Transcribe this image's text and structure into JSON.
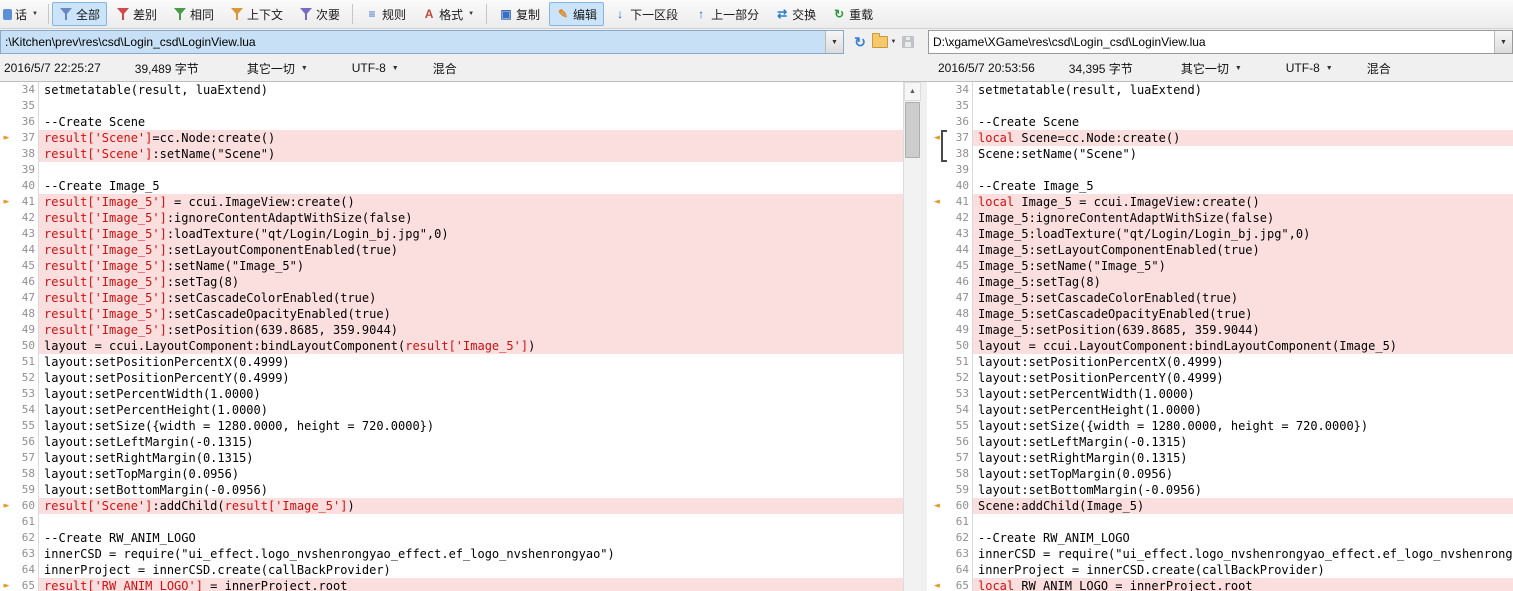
{
  "toolbar": {
    "session": {
      "label": "话"
    },
    "buttons": [
      {
        "label": "全部",
        "icon": "filter-all-icon",
        "active": true
      },
      {
        "label": "差别",
        "icon": "filter-differences-icon"
      },
      {
        "label": "相同",
        "icon": "filter-same-icon"
      },
      {
        "label": "上下文",
        "icon": "filter-context-icon"
      },
      {
        "label": "次要",
        "icon": "filter-minor-icon"
      },
      {
        "sep": true
      },
      {
        "label": "规则",
        "icon": "rules-icon"
      },
      {
        "label": "格式",
        "icon": "format-icon",
        "dropdown": true
      },
      {
        "sep": true
      },
      {
        "label": "复制",
        "icon": "copy-icon"
      },
      {
        "label": "编辑",
        "icon": "edit-icon",
        "active": true
      },
      {
        "label": "下一区段",
        "icon": "next-section-icon"
      },
      {
        "label": "上一部分",
        "icon": "previous-part-icon"
      },
      {
        "label": "交换",
        "icon": "swap-icon"
      },
      {
        "label": "重载",
        "icon": "reload-icon"
      }
    ]
  },
  "colors": {
    "diff_bg": "#fbdfdf",
    "diff_text": "#d01010",
    "marker": "#e8971e",
    "path_selection_bg": "#c7e0f5"
  },
  "left_pane": {
    "path": ":\\Kitchen\\prev\\res\\csd\\Login_csd\\LoginView.lua",
    "info": {
      "modified": "2016/5/7 22:25:27",
      "size": "39,489 字节",
      "format": "其它一切",
      "encoding": "UTF-8",
      "line_ending": "混合"
    },
    "marker_glyph": "►",
    "lines": [
      {
        "n": 34,
        "s": [
          {
            "t": "setmetatable(result, luaExtend)"
          }
        ]
      },
      {
        "n": 35,
        "s": []
      },
      {
        "n": 36,
        "s": [
          {
            "t": "--Create Scene"
          }
        ]
      },
      {
        "n": 37,
        "d": true,
        "m": true,
        "s": [
          {
            "t": "result['Scene']",
            "r": true
          },
          {
            "t": "=cc.Node:create()"
          }
        ]
      },
      {
        "n": 38,
        "d": true,
        "s": [
          {
            "t": "result['Scene']",
            "r": true
          },
          {
            "t": ":setName(\"Scene\")"
          }
        ]
      },
      {
        "n": 39,
        "s": []
      },
      {
        "n": 40,
        "s": [
          {
            "t": "--Create Image_5"
          }
        ]
      },
      {
        "n": 41,
        "d": true,
        "m": true,
        "s": [
          {
            "t": "result['Image_5']",
            "r": true
          },
          {
            "t": " = ccui.ImageView:create()"
          }
        ]
      },
      {
        "n": 42,
        "d": true,
        "s": [
          {
            "t": "result['Image_5']",
            "r": true
          },
          {
            "t": ":ignoreContentAdaptWithSize(false)"
          }
        ]
      },
      {
        "n": 43,
        "d": true,
        "s": [
          {
            "t": "result['Image_5']",
            "r": true
          },
          {
            "t": ":loadTexture(\"qt/Login/Login_bj.jpg\",0)"
          }
        ]
      },
      {
        "n": 44,
        "d": true,
        "s": [
          {
            "t": "result['Image_5']",
            "r": true
          },
          {
            "t": ":setLayoutComponentEnabled(true)"
          }
        ]
      },
      {
        "n": 45,
        "d": true,
        "s": [
          {
            "t": "result['Image_5']",
            "r": true
          },
          {
            "t": ":setName(\"Image_5\")"
          }
        ]
      },
      {
        "n": 46,
        "d": true,
        "s": [
          {
            "t": "result['Image_5']",
            "r": true
          },
          {
            "t": ":setTag(8)"
          }
        ]
      },
      {
        "n": 47,
        "d": true,
        "s": [
          {
            "t": "result['Image_5']",
            "r": true
          },
          {
            "t": ":setCascadeColorEnabled(true)"
          }
        ]
      },
      {
        "n": 48,
        "d": true,
        "s": [
          {
            "t": "result['Image_5']",
            "r": true
          },
          {
            "t": ":setCascadeOpacityEnabled(true)"
          }
        ]
      },
      {
        "n": 49,
        "d": true,
        "s": [
          {
            "t": "result['Image_5']",
            "r": true
          },
          {
            "t": ":setPosition(639.8685, 359.9044)"
          }
        ]
      },
      {
        "n": 50,
        "d": true,
        "s": [
          {
            "t": "layout = ccui.LayoutComponent:bindLayoutComponent("
          },
          {
            "t": "result['Image_5']",
            "r": true
          },
          {
            "t": ")"
          }
        ]
      },
      {
        "n": 51,
        "s": [
          {
            "t": "layout:setPositionPercentX(0.4999)"
          }
        ]
      },
      {
        "n": 52,
        "s": [
          {
            "t": "layout:setPositionPercentY(0.4999)"
          }
        ]
      },
      {
        "n": 53,
        "s": [
          {
            "t": "layout:setPercentWidth(1.0000)"
          }
        ]
      },
      {
        "n": 54,
        "s": [
          {
            "t": "layout:setPercentHeight(1.0000)"
          }
        ]
      },
      {
        "n": 55,
        "s": [
          {
            "t": "layout:setSize({width = 1280.0000, height = 720.0000})"
          }
        ]
      },
      {
        "n": 56,
        "s": [
          {
            "t": "layout:setLeftMargin(-0.1315)"
          }
        ]
      },
      {
        "n": 57,
        "s": [
          {
            "t": "layout:setRightMargin(0.1315)"
          }
        ]
      },
      {
        "n": 58,
        "s": [
          {
            "t": "layout:setTopMargin(0.0956)"
          }
        ]
      },
      {
        "n": 59,
        "s": [
          {
            "t": "layout:setBottomMargin(-0.0956)"
          }
        ]
      },
      {
        "n": 60,
        "d": true,
        "m": true,
        "s": [
          {
            "t": "result['Scene']",
            "r": true
          },
          {
            "t": ":addChild("
          },
          {
            "t": "result['Image_5']",
            "r": true
          },
          {
            "t": ")"
          }
        ]
      },
      {
        "n": 61,
        "s": []
      },
      {
        "n": 62,
        "s": [
          {
            "t": "--Create RW_ANIM_LOGO"
          }
        ]
      },
      {
        "n": 63,
        "s": [
          {
            "t": "innerCSD = require(\"ui_effect.logo_nvshenrongyao_effect.ef_logo_nvshenrongyao\")"
          }
        ]
      },
      {
        "n": 64,
        "s": [
          {
            "t": "innerProject = innerCSD.create(callBackProvider)"
          }
        ]
      },
      {
        "n": 65,
        "d": true,
        "m": true,
        "s": [
          {
            "t": "result['RW_ANIM_LOGO']",
            "r": true
          },
          {
            "t": " = innerProject.root"
          }
        ]
      }
    ]
  },
  "right_pane": {
    "path": "D:\\xgame\\XGame\\res\\csd\\Login_csd\\LoginView.lua",
    "info": {
      "modified": "2016/5/7 20:53:56",
      "size": "34,395 字节",
      "format": "其它一切",
      "encoding": "UTF-8",
      "line_ending": "混合"
    },
    "marker_glyph": "◄",
    "lines": [
      {
        "n": 34,
        "s": [
          {
            "t": "setmetatable(result, luaExtend)"
          }
        ]
      },
      {
        "n": 35,
        "s": []
      },
      {
        "n": 36,
        "s": [
          {
            "t": "--Create Scene"
          }
        ]
      },
      {
        "n": 37,
        "d": true,
        "m": true,
        "s": [
          {
            "t": "local",
            "r": true
          },
          {
            "t": " Scene=cc.Node:create()"
          }
        ]
      },
      {
        "n": 38,
        "s": [
          {
            "t": "Scene:setName(\"Scene\")"
          }
        ]
      },
      {
        "n": 39,
        "s": []
      },
      {
        "n": 40,
        "s": [
          {
            "t": "--Create Image_5"
          }
        ]
      },
      {
        "n": 41,
        "d": true,
        "m": true,
        "s": [
          {
            "t": "local",
            "r": true
          },
          {
            "t": " Image_5 = ccui.ImageView:create()"
          }
        ]
      },
      {
        "n": 42,
        "d": true,
        "s": [
          {
            "t": "Image_5:ignoreContentAdaptWithSize(false)"
          }
        ]
      },
      {
        "n": 43,
        "d": true,
        "s": [
          {
            "t": "Image_5:loadTexture(\"qt/Login/Login_bj.jpg\",0)"
          }
        ]
      },
      {
        "n": 44,
        "d": true,
        "s": [
          {
            "t": "Image_5:setLayoutComponentEnabled(true)"
          }
        ]
      },
      {
        "n": 45,
        "d": true,
        "s": [
          {
            "t": "Image_5:setName(\"Image_5\")"
          }
        ]
      },
      {
        "n": 46,
        "d": true,
        "s": [
          {
            "t": "Image_5:setTag(8)"
          }
        ]
      },
      {
        "n": 47,
        "d": true,
        "s": [
          {
            "t": "Image_5:setCascadeColorEnabled(true)"
          }
        ]
      },
      {
        "n": 48,
        "d": true,
        "s": [
          {
            "t": "Image_5:setCascadeOpacityEnabled(true)"
          }
        ]
      },
      {
        "n": 49,
        "d": true,
        "s": [
          {
            "t": "Image_5:setPosition(639.8685, 359.9044)"
          }
        ]
      },
      {
        "n": 50,
        "d": true,
        "s": [
          {
            "t": "layout = ccui.LayoutComponent:bindLayoutComponent(Image_5)"
          }
        ]
      },
      {
        "n": 51,
        "s": [
          {
            "t": "layout:setPositionPercentX(0.4999)"
          }
        ]
      },
      {
        "n": 52,
        "s": [
          {
            "t": "layout:setPositionPercentY(0.4999)"
          }
        ]
      },
      {
        "n": 53,
        "s": [
          {
            "t": "layout:setPercentWidth(1.0000)"
          }
        ]
      },
      {
        "n": 54,
        "s": [
          {
            "t": "layout:setPercentHeight(1.0000)"
          }
        ]
      },
      {
        "n": 55,
        "s": [
          {
            "t": "layout:setSize({width = 1280.0000, height = 720.0000})"
          }
        ]
      },
      {
        "n": 56,
        "s": [
          {
            "t": "layout:setLeftMargin(-0.1315)"
          }
        ]
      },
      {
        "n": 57,
        "s": [
          {
            "t": "layout:setRightMargin(0.1315)"
          }
        ]
      },
      {
        "n": 58,
        "s": [
          {
            "t": "layout:setTopMargin(0.0956)"
          }
        ]
      },
      {
        "n": 59,
        "s": [
          {
            "t": "layout:setBottomMargin(-0.0956)"
          }
        ]
      },
      {
        "n": 60,
        "d": true,
        "m": true,
        "s": [
          {
            "t": "Scene:addChild(Image_5)"
          }
        ]
      },
      {
        "n": 61,
        "s": []
      },
      {
        "n": 62,
        "s": [
          {
            "t": "--Create RW_ANIM_LOGO"
          }
        ]
      },
      {
        "n": 63,
        "s": [
          {
            "t": "innerCSD = require(\"ui_effect.logo_nvshenrongyao_effect.ef_logo_nvshenrongyao\")"
          }
        ]
      },
      {
        "n": 64,
        "s": [
          {
            "t": "innerProject = innerCSD.create(callBackProvider)"
          }
        ]
      },
      {
        "n": 65,
        "d": true,
        "m": true,
        "s": [
          {
            "t": "local",
            "r": true
          },
          {
            "t": " RW_ANIM_LOGO = innerProject.root"
          }
        ]
      }
    ]
  }
}
